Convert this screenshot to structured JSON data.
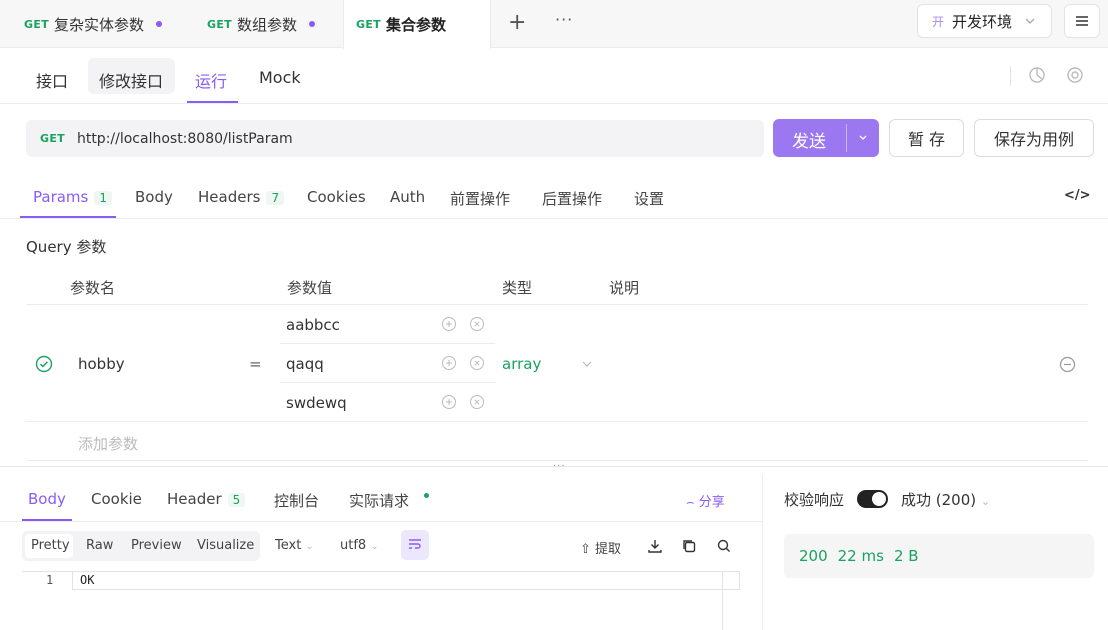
{
  "file_tabs": [
    {
      "method": "GET",
      "title": "复杂实体参数",
      "modified": true
    },
    {
      "method": "GET",
      "title": "数组参数",
      "modified": true
    },
    {
      "method": "GET",
      "title": "集合参数",
      "modified": false
    }
  ],
  "env": {
    "badge": "开",
    "name": "开发环境"
  },
  "subnav": {
    "items": [
      "接口",
      "修改接口",
      "运行",
      "Mock"
    ],
    "active": "运行"
  },
  "request": {
    "method": "GET",
    "url": "http://localhost:8080/listParam",
    "send_label": "发送",
    "save_label": "暂 存",
    "save_case_label": "保存为用例"
  },
  "param_tabs": [
    {
      "label": "Params",
      "count": "1"
    },
    {
      "label": "Body"
    },
    {
      "label": "Headers",
      "count": "7"
    },
    {
      "label": "Cookies"
    },
    {
      "label": "Auth"
    },
    {
      "label": "前置操作"
    },
    {
      "label": "后置操作"
    },
    {
      "label": "设置"
    }
  ],
  "query": {
    "title": "Query 参数",
    "headers": [
      "参数名",
      "参数值",
      "类型",
      "说明"
    ],
    "row": {
      "name": "hobby",
      "eq": "=",
      "values": [
        "aabbcc",
        "qaqq",
        "swdewq"
      ],
      "type": "array",
      "enabled": true
    },
    "add_placeholder": "添加参数"
  },
  "response": {
    "tabs": [
      {
        "label": "Body"
      },
      {
        "label": "Cookie"
      },
      {
        "label": "Header",
        "count": "5"
      },
      {
        "label": "控制台"
      },
      {
        "label": "实际请求",
        "dot": true
      }
    ],
    "share_label": "分享",
    "view_modes": [
      "Pretty",
      "Raw",
      "Preview",
      "Visualize"
    ],
    "format": "Text",
    "encoding": "utf8",
    "extract_label": "提取",
    "line_number": "1",
    "body_text": "OK",
    "validate_label": "校验响应",
    "validate_status": "成功 (200)",
    "status_code": "200",
    "time": "22 ms",
    "size": "2 B"
  },
  "colors": {
    "accent": "#8a5cf6",
    "success": "#1aa260"
  }
}
